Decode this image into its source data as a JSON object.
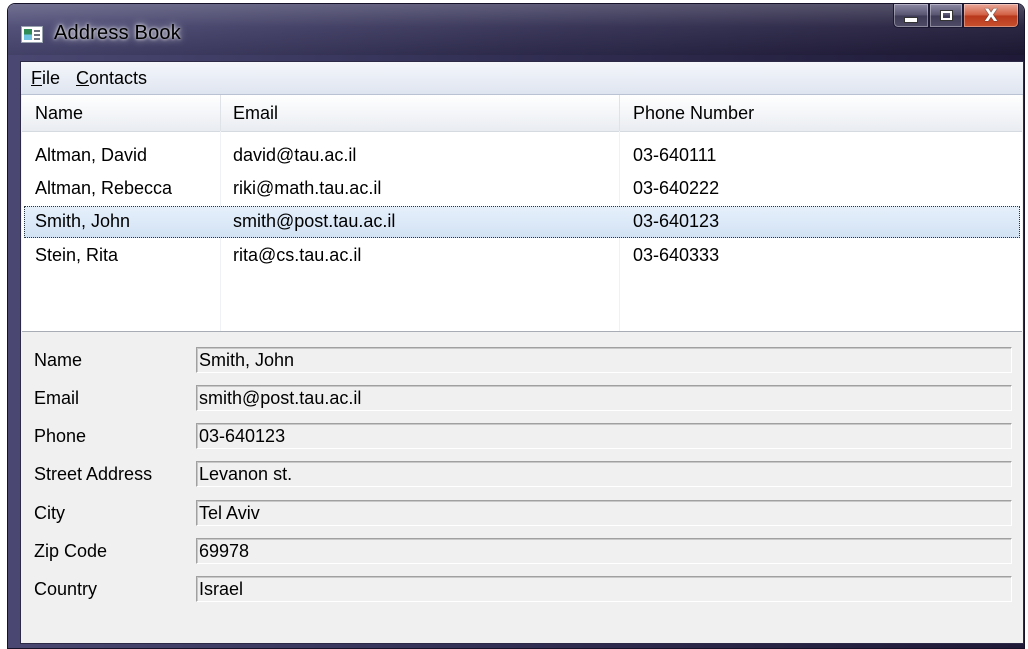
{
  "window": {
    "title": "Address Book",
    "controls": {
      "minimize_icon": "minimize-icon",
      "maximize_icon": "maximize-icon",
      "close_icon": "close-icon",
      "close_glyph": "X"
    },
    "colors": {
      "titlebar": "#2f2c50",
      "selection": "#d2e2f4",
      "close_button": "#c9512f"
    }
  },
  "menu": {
    "file": {
      "mnemonic": "F",
      "rest": "ile"
    },
    "contacts": {
      "mnemonic": "C",
      "rest": "ontacts"
    }
  },
  "table": {
    "columns": [
      "Name",
      "Email",
      "Phone Number"
    ],
    "rows": [
      {
        "name": "Altman, David",
        "email": "david@tau.ac.il",
        "phone": "03-640111",
        "selected": false
      },
      {
        "name": "Altman, Rebecca",
        "email": "riki@math.tau.ac.il",
        "phone": "03-640222",
        "selected": false
      },
      {
        "name": "Smith, John",
        "email": "smith@post.tau.ac.il",
        "phone": "03-640123",
        "selected": true
      },
      {
        "name": "Stein, Rita",
        "email": "rita@cs.tau.ac.il",
        "phone": "03-640333",
        "selected": false
      }
    ]
  },
  "details": {
    "fields": [
      {
        "label": "Name",
        "value": "Smith, John"
      },
      {
        "label": "Email",
        "value": "smith@post.tau.ac.il"
      },
      {
        "label": "Phone",
        "value": "03-640123"
      },
      {
        "label": "Street Address",
        "value": "Levanon st."
      },
      {
        "label": "City",
        "value": "Tel Aviv"
      },
      {
        "label": "Zip Code",
        "value": "69978"
      },
      {
        "label": "Country",
        "value": "Israel"
      }
    ]
  }
}
